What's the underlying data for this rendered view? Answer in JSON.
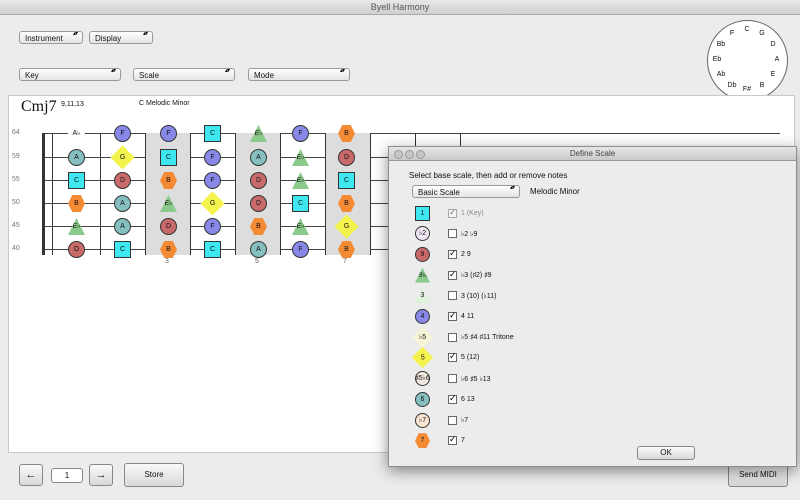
{
  "window": {
    "title": "Byell Harmony"
  },
  "toolbar": {
    "instrument": "Instrument",
    "display": "Display",
    "key": "Key",
    "scale": "Scale",
    "mode": "Mode"
  },
  "circle_of_fifths": [
    "C",
    "G",
    "D",
    "A",
    "E",
    "B",
    "F#",
    "Db",
    "Ab",
    "Eb",
    "Bb",
    "F"
  ],
  "chord": {
    "name": "Cmj7",
    "extensions": "9,11,13",
    "scale_name": "C Melodic Minor"
  },
  "string_labels": [
    "64",
    "59",
    "55",
    "50",
    "45",
    "40"
  ],
  "fret_numbers": [
    "3",
    "5",
    "7"
  ],
  "bottom": {
    "prev_icon": "←",
    "position": "1",
    "next_icon": "→",
    "store": "Store",
    "send_midi": "Send MIDI"
  },
  "dialog": {
    "title": "Define Scale",
    "instruction": "Select base scale, then add or remove notes",
    "base_scale_select": "Basic Scale",
    "selected_scale": "Melodic Minor",
    "ok": "OK",
    "rows": [
      {
        "symbol": "1",
        "label": "1 (Key)",
        "checked": true,
        "color": "#3ee8f0",
        "shape": "sq"
      },
      {
        "symbol": "♭2",
        "label": "♭2  ♭9",
        "checked": false,
        "color": "#f1e7f4",
        "shape": "circ"
      },
      {
        "symbol": "9",
        "label": "2  9",
        "checked": true,
        "color": "#c86a6a",
        "shape": "circ"
      },
      {
        "symbol": "♯9♭3",
        "label": "♭3   (♯2)   ♯9",
        "checked": true,
        "color": "#8cc98c",
        "shape": "tri"
      },
      {
        "symbol": "3",
        "label": "3  (10)  (♭11)",
        "checked": false,
        "color": "#dff2dc",
        "shape": "tri"
      },
      {
        "symbol": "4",
        "label": "4  11",
        "checked": true,
        "color": "#8888e8",
        "shape": "circ"
      },
      {
        "symbol": "♭5",
        "label": "♭5   ♯4   ♯11  Tritone",
        "checked": false,
        "color": "#f7f3d6",
        "shape": "dia"
      },
      {
        "symbol": "5",
        "label": "5 (12)",
        "checked": true,
        "color": "#f4f24c",
        "shape": "dia"
      },
      {
        "symbol": "♯5♭6",
        "label": "♭6   ♯5   ♭13",
        "checked": false,
        "color": "#f3ebe0",
        "shape": "circ"
      },
      {
        "symbol": "6",
        "label": "6  13",
        "checked": true,
        "color": "#86bfc0",
        "shape": "circ"
      },
      {
        "symbol": "♭7",
        "label": "♭7",
        "checked": false,
        "color": "#fbe7d2",
        "shape": "circ"
      },
      {
        "symbol": "7",
        "label": "7",
        "checked": true,
        "color": "#f58a35",
        "shape": "hex"
      }
    ]
  },
  "notes": [
    {
      "name": "F",
      "deg": "4",
      "color": "#8888e8",
      "shape": "circ"
    },
    {
      "name": "C",
      "deg": "1",
      "color": "#3ee8f0",
      "shape": "sq"
    },
    {
      "name": "G",
      "deg": "5",
      "color": "#f4f24c",
      "shape": "dia"
    },
    {
      "name": "D",
      "deg": "9",
      "color": "#c86a6a",
      "shape": "circ"
    },
    {
      "name": "A",
      "deg": "6",
      "color": "#86bfc0",
      "shape": "circ"
    },
    {
      "name": "B",
      "deg": "7",
      "color": "#f58a35",
      "shape": "hex"
    },
    {
      "name": "E♭",
      "deg": "♯9♭3",
      "color": "#8cc98c",
      "shape": "tri"
    },
    {
      "name": "A♭",
      "deg": "♭7",
      "color": "#ffffff",
      "shape": "hex"
    }
  ]
}
